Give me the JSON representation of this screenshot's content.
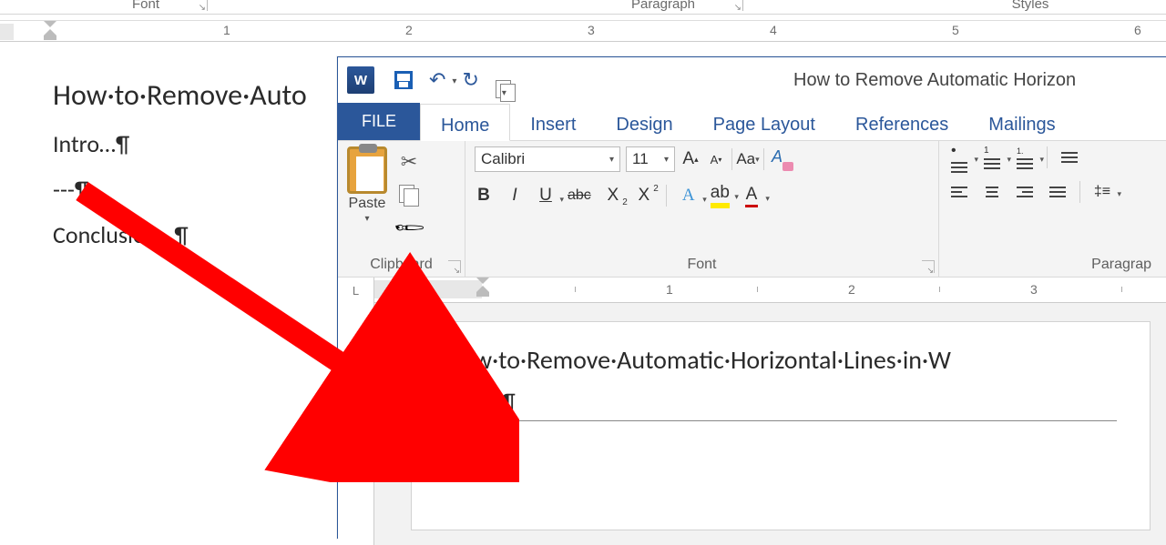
{
  "background": {
    "groups": {
      "font": "Font",
      "paragraph": "Paragraph",
      "styles": "Styles"
    },
    "ruler": {
      "numbers": [
        "1",
        "2",
        "3",
        "4",
        "5",
        "6"
      ]
    },
    "doc": {
      "title": "How·to·Remove·Auto",
      "intro": "Intro…¶",
      "dashes": "---¶",
      "conclusion": "Conclusion…¶"
    }
  },
  "foreground": {
    "doc_title": "How to Remove Automatic Horizon",
    "tabs": {
      "file": "FILE",
      "home": "Home",
      "insert": "Insert",
      "design": "Design",
      "pagelayout": "Page Layout",
      "references": "References",
      "mailings": "Mailings"
    },
    "clipboard": {
      "paste": "Paste",
      "label": "Clipboard"
    },
    "font": {
      "name": "Calibri",
      "size": "11",
      "grow": "A",
      "shrink": "A",
      "case": "Aa",
      "bold": "B",
      "italic": "I",
      "underline": "U",
      "strike": "abc",
      "subscript": "X",
      "superscript": "X",
      "texteffect": "A",
      "highlight": "ab",
      "fontcolor": "A",
      "label": "Font"
    },
    "paragraph": {
      "label": "Paragrap"
    },
    "ruler": {
      "corner": "L",
      "numbers": [
        "1",
        "2",
        "3"
      ]
    },
    "page": {
      "title": "How·to·Remove·Automatic·Horizontal·Lines·in·W",
      "intro": "Intro…¶",
      "blank": "¶"
    }
  }
}
